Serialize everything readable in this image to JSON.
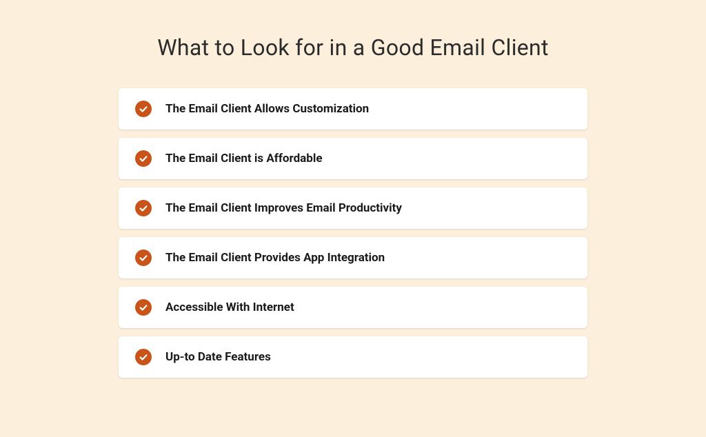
{
  "title": "What to Look for in a Good Email Client",
  "items": [
    {
      "label": "The Email Client Allows Customization"
    },
    {
      "label": "The Email Client is Affordable"
    },
    {
      "label": "The Email Client Improves Email Productivity"
    },
    {
      "label": "The Email Client Provides App Integration"
    },
    {
      "label": "Accessible With Internet"
    },
    {
      "label": "Up-to Date Features"
    }
  ],
  "colors": {
    "background": "#fcefdc",
    "accent": "#c9541a",
    "card": "#ffffff",
    "text": "#1a1a1a"
  }
}
